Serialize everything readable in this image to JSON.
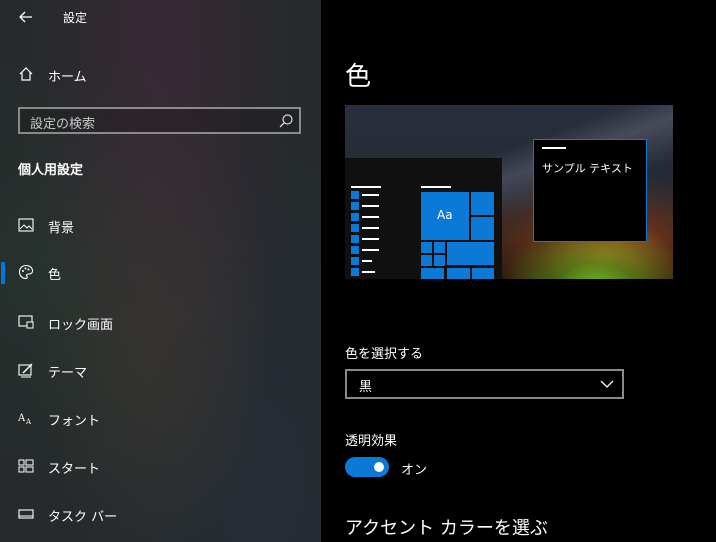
{
  "window": {
    "title": "設定"
  },
  "sidebar": {
    "home_label": "ホーム",
    "search_placeholder": "設定の検索",
    "section_title": "個人用設定",
    "items": [
      {
        "label": "背景",
        "icon": "picture-icon",
        "active": false
      },
      {
        "label": "色",
        "icon": "palette-icon",
        "active": true
      },
      {
        "label": "ロック画面",
        "icon": "lock-screen-icon",
        "active": false
      },
      {
        "label": "テーマ",
        "icon": "theme-icon",
        "active": false
      },
      {
        "label": "フォント",
        "icon": "font-icon",
        "active": false
      },
      {
        "label": "スタート",
        "icon": "start-icon",
        "active": false
      },
      {
        "label": "タスク バー",
        "icon": "taskbar-icon",
        "active": false
      }
    ]
  },
  "main": {
    "title": "色",
    "preview": {
      "sample_text": "サンプル テキスト",
      "tile_label": "Aa"
    },
    "color_select": {
      "label": "色を選択する",
      "value": "黒"
    },
    "transparency": {
      "label": "透明効果",
      "state": "オン",
      "enabled": true
    },
    "accent_heading": "アクセント カラーを選ぶ"
  },
  "colors": {
    "accent": "#0078d7",
    "background": "#000000",
    "sidebar": "#262a2b"
  }
}
